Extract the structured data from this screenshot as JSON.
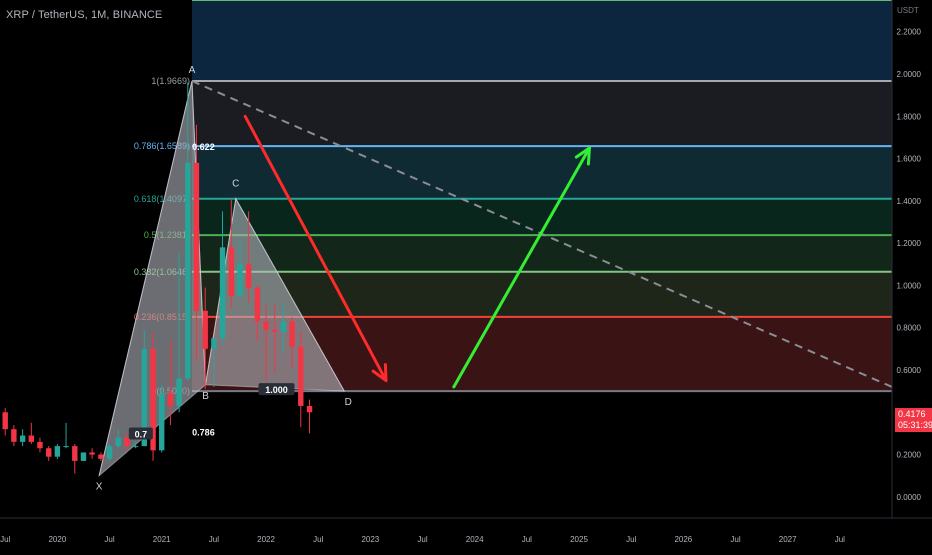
{
  "header": {
    "title": "XRP / TetherUS, 1M, BINANCE"
  },
  "price_axis": {
    "currency": "USDT",
    "current_price": "0.4176",
    "countdown": "05:31:39"
  },
  "colors": {
    "up": "#26a69a",
    "down": "#f23645",
    "background": "#000000",
    "pattern_fill": "#b2b5be",
    "arrow_down": "#ff2a2a",
    "arrow_up": "#33ee33",
    "dashed_line": "#8a8d96"
  },
  "annotations": {
    "xabcd": [
      {
        "label": "X",
        "time": 2020.4,
        "price": 0.1
      },
      {
        "label": "A",
        "time": 2021.29,
        "price": 1.9669
      },
      {
        "label": "B",
        "time": 2021.42,
        "price": 0.53
      },
      {
        "label": "C",
        "time": 2021.71,
        "price": 1.41
      },
      {
        "label": "D",
        "time": 2022.75,
        "price": 0.5
      }
    ],
    "ratios": [
      {
        "text": "0.622",
        "time": 2021.4,
        "price": 1.65
      },
      {
        "text": "0.786",
        "time": 2021.4,
        "price": 0.3
      },
      {
        "text": "0.7",
        "time": 2020.8,
        "price": 0.29
      },
      {
        "text": "1.000",
        "time": 2022.1,
        "price": 0.5
      }
    ],
    "trend_arrows": [
      {
        "direction": "down",
        "from_time": 2021.8,
        "from_price": 1.8,
        "to_time": 2023.15,
        "to_price": 0.55
      },
      {
        "direction": "up",
        "from_time": 2023.8,
        "from_price": 0.52,
        "to_time": 2025.1,
        "to_price": 1.65
      }
    ],
    "dashed_trend": {
      "from_time": 2021.29,
      "from_price": 1.9669,
      "to_time": 2028.0,
      "to_price": 0.52
    }
  },
  "chart_data": {
    "type": "candlestick",
    "title": "XRP / TetherUS, 1M, BINANCE",
    "ylabel": "USDT",
    "ylim": [
      -0.1,
      2.35
    ],
    "xlim": [
      2019.45,
      2028.0
    ],
    "y_ticks": [
      "2.2000",
      "2.0000",
      "1.8000",
      "1.6000",
      "1.4000",
      "1.2000",
      "1.0000",
      "0.8000",
      "0.6000",
      "0.4000",
      "0.2000",
      "0.0000"
    ],
    "x_ticks": [
      {
        "label": "Jul",
        "t": 2019.5
      },
      {
        "label": "2020",
        "t": 2020.0
      },
      {
        "label": "Jul",
        "t": 2020.5
      },
      {
        "label": "2021",
        "t": 2021.0
      },
      {
        "label": "Jul",
        "t": 2021.5
      },
      {
        "label": "2022",
        "t": 2022.0
      },
      {
        "label": "Jul",
        "t": 2022.5
      },
      {
        "label": "2023",
        "t": 2023.0
      },
      {
        "label": "Jul",
        "t": 2023.5
      },
      {
        "label": "2024",
        "t": 2024.0
      },
      {
        "label": "Jul",
        "t": 2024.5
      },
      {
        "label": "2025",
        "t": 2025.0
      },
      {
        "label": "Jul",
        "t": 2025.5
      },
      {
        "label": "2026",
        "t": 2026.0
      },
      {
        "label": "Jul",
        "t": 2026.5
      },
      {
        "label": "2027",
        "t": 2027.0
      },
      {
        "label": "Jul",
        "t": 2027.5
      }
    ],
    "candles": [
      {
        "t": 2019.5,
        "o": 0.4,
        "h": 0.42,
        "l": 0.29,
        "c": 0.32
      },
      {
        "t": 2019.583,
        "o": 0.32,
        "h": 0.34,
        "l": 0.24,
        "c": 0.26
      },
      {
        "t": 2019.667,
        "o": 0.26,
        "h": 0.32,
        "l": 0.24,
        "c": 0.29
      },
      {
        "t": 2019.75,
        "o": 0.29,
        "h": 0.35,
        "l": 0.25,
        "c": 0.26
      },
      {
        "t": 2019.833,
        "o": 0.26,
        "h": 0.28,
        "l": 0.21,
        "c": 0.23
      },
      {
        "t": 2019.917,
        "o": 0.23,
        "h": 0.24,
        "l": 0.17,
        "c": 0.19
      },
      {
        "t": 2020.0,
        "o": 0.19,
        "h": 0.25,
        "l": 0.18,
        "c": 0.24
      },
      {
        "t": 2020.083,
        "o": 0.24,
        "h": 0.35,
        "l": 0.23,
        "c": 0.24
      },
      {
        "t": 2020.167,
        "o": 0.24,
        "h": 0.25,
        "l": 0.11,
        "c": 0.17
      },
      {
        "t": 2020.25,
        "o": 0.17,
        "h": 0.21,
        "l": 0.17,
        "c": 0.21
      },
      {
        "t": 2020.333,
        "o": 0.21,
        "h": 0.23,
        "l": 0.18,
        "c": 0.2
      },
      {
        "t": 2020.417,
        "o": 0.2,
        "h": 0.21,
        "l": 0.17,
        "c": 0.18
      },
      {
        "t": 2020.5,
        "o": 0.18,
        "h": 0.25,
        "l": 0.17,
        "c": 0.24
      },
      {
        "t": 2020.583,
        "o": 0.24,
        "h": 0.32,
        "l": 0.23,
        "c": 0.28
      },
      {
        "t": 2020.667,
        "o": 0.28,
        "h": 0.3,
        "l": 0.22,
        "c": 0.24
      },
      {
        "t": 2020.75,
        "o": 0.24,
        "h": 0.26,
        "l": 0.23,
        "c": 0.24
      },
      {
        "t": 2020.833,
        "o": 0.24,
        "h": 0.79,
        "l": 0.24,
        "c": 0.7
      },
      {
        "t": 2020.917,
        "o": 0.7,
        "h": 0.78,
        "l": 0.17,
        "c": 0.22
      },
      {
        "t": 2021.0,
        "o": 0.22,
        "h": 0.53,
        "l": 0.21,
        "c": 0.49
      },
      {
        "t": 2021.083,
        "o": 0.49,
        "h": 0.74,
        "l": 0.34,
        "c": 0.43
      },
      {
        "t": 2021.167,
        "o": 0.43,
        "h": 1.15,
        "l": 0.4,
        "c": 0.56
      },
      {
        "t": 2021.25,
        "o": 0.56,
        "h": 1.96,
        "l": 0.55,
        "c": 1.58
      },
      {
        "t": 2021.333,
        "o": 1.58,
        "h": 1.76,
        "l": 0.65,
        "c": 0.88
      },
      {
        "t": 2021.417,
        "o": 0.88,
        "h": 0.99,
        "l": 0.51,
        "c": 0.7
      },
      {
        "t": 2021.5,
        "o": 0.7,
        "h": 0.75,
        "l": 0.52,
        "c": 0.75
      },
      {
        "t": 2021.583,
        "o": 0.75,
        "h": 1.35,
        "l": 0.72,
        "c": 1.18
      },
      {
        "t": 2021.667,
        "o": 1.18,
        "h": 1.41,
        "l": 0.89,
        "c": 0.95
      },
      {
        "t": 2021.75,
        "o": 0.95,
        "h": 1.22,
        "l": 0.94,
        "c": 1.1
      },
      {
        "t": 2021.833,
        "o": 1.1,
        "h": 1.35,
        "l": 0.92,
        "c": 0.99
      },
      {
        "t": 2021.917,
        "o": 0.99,
        "h": 1.0,
        "l": 0.74,
        "c": 0.83
      },
      {
        "t": 2022.0,
        "o": 0.83,
        "h": 0.91,
        "l": 0.55,
        "c": 0.79
      },
      {
        "t": 2022.083,
        "o": 0.79,
        "h": 0.91,
        "l": 0.59,
        "c": 0.78
      },
      {
        "t": 2022.167,
        "o": 0.78,
        "h": 0.91,
        "l": 0.68,
        "c": 0.83
      },
      {
        "t": 2022.25,
        "o": 0.83,
        "h": 0.85,
        "l": 0.61,
        "c": 0.71
      },
      {
        "t": 2022.333,
        "o": 0.71,
        "h": 0.78,
        "l": 0.33,
        "c": 0.43
      },
      {
        "t": 2022.417,
        "o": 0.43,
        "h": 0.46,
        "l": 0.3,
        "c": 0.4
      }
    ],
    "fib_levels": [
      {
        "ratio": "1",
        "price": 1.9669,
        "label": "1(1.9669)",
        "color": "#a7a7ad",
        "label_color": "#9aa0a6",
        "fill": "#0c2640"
      },
      {
        "ratio": "0.786",
        "price": 1.6589,
        "label": "0.786(1.6589)",
        "color": "#64b5f6",
        "label_color": "#64b5f6",
        "fill": "#1a1c22"
      },
      {
        "ratio": "0.618",
        "price": 1.4097,
        "label": "0.618(1.4097)",
        "color": "#26a69a",
        "label_color": "#26a69a",
        "fill": "#0f2a33"
      },
      {
        "ratio": "0.5",
        "price": 1.2381,
        "label": "0.5(1.2381)",
        "color": "#4caf50",
        "label_color": "#4caf50",
        "fill": "#08261c"
      },
      {
        "ratio": "0.382",
        "price": 1.0646,
        "label": "0.382(1.0646)",
        "color": "#81c784",
        "label_color": "#81c784",
        "fill": "#13261a"
      },
      {
        "ratio": "0.236",
        "price": 0.8515,
        "label": "0.236(0.8515)",
        "color": "#f44336",
        "label_color": "#f44336",
        "fill": "#1d2618"
      },
      {
        "ratio": "0",
        "price": 0.5,
        "label": "0(0.5000)",
        "color": "#787b86",
        "label_color": "#787b86",
        "fill": "#3a1414"
      }
    ],
    "extension_level": {
      "price": 2.35,
      "color": "#66bb6a"
    }
  }
}
